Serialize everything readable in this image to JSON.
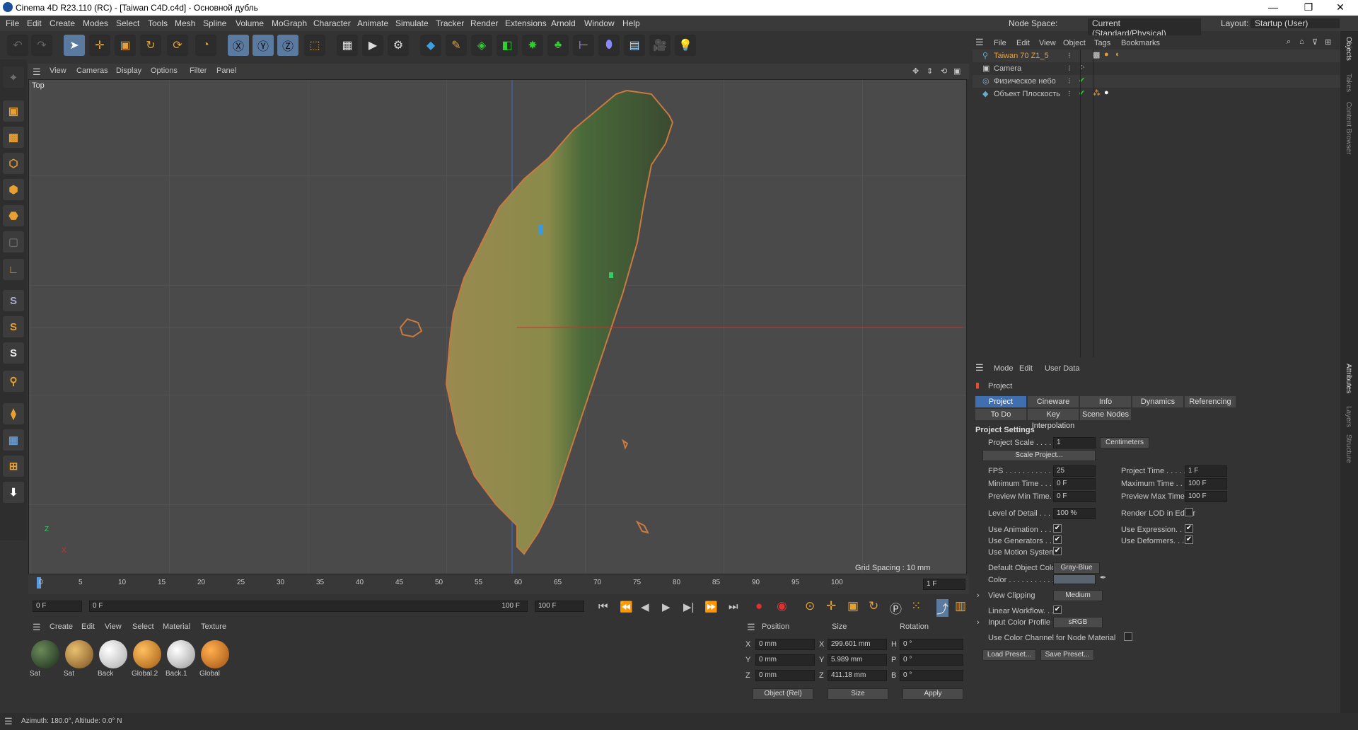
{
  "titlebar": {
    "title": "Cinema 4D R23.110 (RC) - [Taiwan C4D.c4d] - Основной дубль",
    "nodespace_label": "Node Space:",
    "nodespace_value": "Current (Standard/Physical)",
    "layout_label": "Layout:",
    "layout_value": "Startup (User)",
    "minimize": "—",
    "maximize": "❐",
    "close": "✕"
  },
  "menubar": [
    "File",
    "Edit",
    "Create",
    "Modes",
    "Select",
    "Tools",
    "Mesh",
    "Spline",
    "Volume",
    "MoGraph",
    "Character",
    "Animate",
    "Simulate",
    "Tracker",
    "Render",
    "Extensions",
    "Arnold",
    "Window",
    "Help"
  ],
  "viewport": {
    "menu": [
      "View",
      "Cameras",
      "Display",
      "Options",
      "Filter",
      "Panel"
    ],
    "view_name": "Top",
    "grid_spacing": "Grid Spacing : 10 mm"
  },
  "timeline": {
    "ticks": [
      "0",
      "5",
      "10",
      "15",
      "20",
      "25",
      "30",
      "35",
      "40",
      "45",
      "50",
      "55",
      "60",
      "65",
      "70",
      "75",
      "80",
      "85",
      "90",
      "95",
      "100"
    ],
    "current_frame": "1 F",
    "start": "0 F",
    "range_start": "0 F",
    "range_end": "100 F",
    "end": "100 F"
  },
  "materials": {
    "menu": [
      "Create",
      "Edit",
      "View",
      "Select",
      "Material",
      "Texture"
    ],
    "items": [
      {
        "name": "Sat",
        "color": "#2c3a2a"
      },
      {
        "name": "Sat",
        "color": "#b08040"
      },
      {
        "name": "Back",
        "color": "#e8e8e8"
      },
      {
        "name": "Global.2",
        "color": "#e09030"
      },
      {
        "name": "Back.1",
        "color": "#d8d8d8"
      },
      {
        "name": "Global",
        "color": "#e08a30"
      }
    ]
  },
  "coords": {
    "headers": [
      "Position",
      "Size",
      "Rotation"
    ],
    "rows": [
      {
        "axis": "X",
        "pos": "0 mm",
        "size_axis": "X",
        "size": "299.601 mm",
        "rot_axis": "H",
        "rot": "0 °"
      },
      {
        "axis": "Y",
        "pos": "0 mm",
        "size_axis": "Y",
        "size": "5.989 mm",
        "rot_axis": "P",
        "rot": "0 °"
      },
      {
        "axis": "Z",
        "pos": "0 mm",
        "size_axis": "Z",
        "size": "411.18 mm",
        "rot_axis": "B",
        "rot": "0 °"
      }
    ],
    "mode": "Object (Rel)",
    "size_mode": "Size",
    "apply": "Apply"
  },
  "status": "Azimuth: 180.0°, Altitude: 0.0°  N",
  "objects": {
    "menu": [
      "File",
      "Edit",
      "View",
      "Object",
      "Tags",
      "Bookmarks"
    ],
    "items": [
      {
        "name": "Taiwan 70 Z1_5",
        "color": "#f0a030"
      },
      {
        "name": "Camera",
        "color": "#d8d8d8"
      },
      {
        "name": "Физическое небо",
        "color": "#d8d8d8"
      },
      {
        "name": "Объект Плоскость",
        "color": "#d8d8d8"
      }
    ]
  },
  "attributes": {
    "menu": [
      "Mode",
      "Edit",
      "User Data"
    ],
    "header": "Project",
    "tabs_row1": [
      "Project Settings",
      "Cineware",
      "Info",
      "Dynamics",
      "Referencing"
    ],
    "tabs_row2": [
      "To Do",
      "Key Interpolation",
      "Scene Nodes"
    ],
    "section": "Project Settings",
    "project_scale_label": "Project Scale . . . . .",
    "project_scale": "1",
    "project_scale_unit": "Centimeters",
    "scale_project": "Scale Project...",
    "fps_label": "FPS . . . . . . . . . . . .",
    "fps": "25",
    "project_time_label": "Project Time . . . . .",
    "project_time": "1 F",
    "min_time_label": "Minimum Time . . .",
    "min_time": "0 F",
    "max_time_label": "Maximum Time . . .",
    "max_time": "100 F",
    "prev_min_label": "Preview Min Time. .",
    "prev_min": "0 F",
    "prev_max_label": "Preview Max Time . .",
    "prev_max": "100 F",
    "lod_label": "Level of Detail . . .",
    "lod": "100 %",
    "render_lod_label": "Render LOD in Editor",
    "use_animation": "Use Animation . . . .",
    "use_expression": "Use Expression. . . .",
    "use_generators": "Use Generators . . .",
    "use_deformers": "Use Deformers. . . .",
    "use_motion": "Use Motion System",
    "default_color_label": "Default Object Color",
    "default_color": "Gray-Blue",
    "color_label": "Color . . . . . . . . . . .",
    "view_clipping_label": "View Clipping",
    "view_clipping": "Medium",
    "linear_workflow": "Linear Workflow. . .",
    "input_profile_label": "Input Color Profile",
    "input_profile": "sRGB",
    "use_color_channel": "Use Color Channel for Node Material",
    "load_preset": "Load Preset...",
    "save_preset": "Save Preset..."
  },
  "side_tabs": [
    "Objects",
    "Takes",
    "Content Browser",
    "Attributes",
    "Layers",
    "Structure"
  ]
}
